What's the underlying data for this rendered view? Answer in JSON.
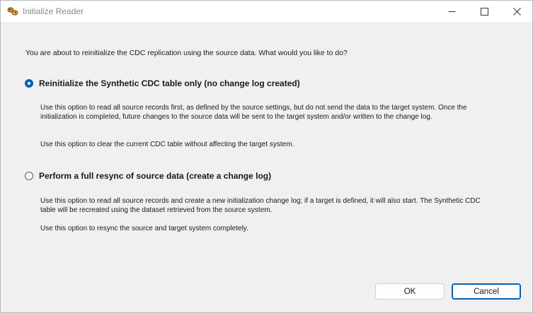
{
  "window": {
    "title": "Initialize Reader",
    "icon": "app-icon"
  },
  "dialog": {
    "prompt": "You are about to reinitialize the CDC replication using the source data.  What would you like to do?",
    "options": [
      {
        "label": "Reinitialize the Synthetic CDC table only (no change log created)",
        "selected": true,
        "description_1": "Use this option to read all source records first, as defined by the source settings, but do not send the data to the target system. Once the initialization is completed, future changes to the source data will be sent to the target system and/or written to the change log.",
        "description_2": "Use this option to clear the current CDC table without affecting the target system."
      },
      {
        "label": "Perform a full resync of source data (create a change log)",
        "selected": false,
        "description_1": "Use this option to read all source records and create a new initialization change log; if a target is defined, it will also start. The Synthetic CDC table will be recreated using the dataset retrieved from the source system.",
        "description_2": "Use this option to resync the source and target system completely."
      }
    ],
    "ok_label": "OK",
    "cancel_label": "Cancel"
  },
  "colors": {
    "accent": "#005fb8",
    "background": "#f0f0f0"
  }
}
